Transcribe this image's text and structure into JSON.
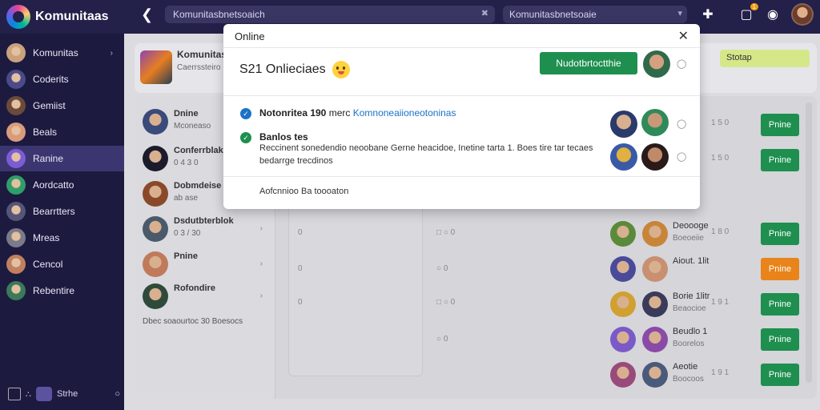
{
  "topbar": {
    "app_title": "Komunitaas",
    "search_value": "Komunitasbnetsoaich",
    "search_clear_icon": "x-icon",
    "filter_value": "Komunitasbnetsoaie",
    "filter_chevron": "chevron-down-icon",
    "notification_badge": "1"
  },
  "sidebar": {
    "items": [
      {
        "label": "Komunitas",
        "color": "#c9a27c",
        "has_chevron": true
      },
      {
        "label": "Coderits",
        "color": "#4b4b8a"
      },
      {
        "label": "Gemiist",
        "color": "#6b4a3a"
      },
      {
        "label": "Beals",
        "color": "#d99b7a"
      },
      {
        "label": "Ranine",
        "color": "#7c5cd6",
        "active": true
      },
      {
        "label": "Aordcatto",
        "color": "#2f9e6a"
      },
      {
        "label": "Bearrtters",
        "color": "#555577"
      },
      {
        "label": "Mreas",
        "color": "#7a7a8a"
      },
      {
        "label": "Cencol",
        "color": "#c08060"
      },
      {
        "label": "Rebentire",
        "color": "#3a7a5a"
      }
    ],
    "footer_label": "Strhe"
  },
  "header_card": {
    "title": "Komunitas",
    "subtitle": "Caerrssteiro",
    "status_tag": "Stotap"
  },
  "chat_list": [
    {
      "name": "Dnine",
      "sub": "Mconeaso",
      "color": "#3a4a7a"
    },
    {
      "name": "Conferrblak",
      "sub": "0 4 3 0",
      "color": "#1b1b2b"
    },
    {
      "name": "Dobmdeise",
      "sub": "ab ase",
      "color": "#8a4a2a"
    },
    {
      "name": "Dsdutbterblok",
      "sub": "0 3 / 30",
      "color": "#4a5a6a"
    },
    {
      "name": "Pnine",
      "sub": "",
      "color": "#c07a5a"
    },
    {
      "name": "Rofondire",
      "sub": "",
      "color": "#2f4a3a"
    }
  ],
  "chat_footer": "Dbec soaourtoc 30 Boesocs",
  "members": [
    {
      "name": "Deoooge",
      "sub": "Boeoeiie",
      "num": "1 8 0",
      "btn": "Pnine",
      "btn_color": "#1e8f4f",
      "c1": "#5a8a3a",
      "c2": "#c8853a"
    },
    {
      "name": "Aiout. 1lit",
      "sub": "",
      "num": "",
      "btn": "Pnine",
      "btn_color": "#e8841a",
      "c1": "#4a4a9a",
      "c2": "#c89070"
    },
    {
      "name": "Borie 1litr",
      "sub": "Beaocioe",
      "num": "1 9 1",
      "btn": "Pnine",
      "btn_color": "#1e8f4f",
      "c1": "#d0a030",
      "c2": "#3a3a5a"
    },
    {
      "name": "Beudlo 1",
      "sub": "Boorelos",
      "num": "",
      "btn": "Pnine",
      "btn_color": "#1e8f4f",
      "c1": "#7a5ac8",
      "c2": "#8a4aa8"
    },
    {
      "name": "Aeotie",
      "sub": "Boocoos",
      "num": "1 9 1",
      "btn": "Pnine",
      "btn_color": "#1e8f4f",
      "c1": "#9a4a7a",
      "c2": "#4a5a7a"
    },
    {
      "name": "",
      "sub": "",
      "num": "1 5 0",
      "btn": "Pnine",
      "btn_color": "#1e8f4f",
      "c1": "",
      "c2": ""
    },
    {
      "name": "",
      "sub": "",
      "num": "1 5 0",
      "btn": "Pnine",
      "btn_color": "#1e8f4f",
      "c1": "",
      "c2": ""
    }
  ],
  "modal": {
    "title": "Online",
    "headline": "S21 Onlieciaes",
    "primary_button": "Nudotbrtoctthie",
    "item1_title": "Notonritea 190",
    "item1_rest": "merc",
    "item1_link": "Komnoneaiioneotoninas",
    "item2_title": "Banlos tes",
    "item2_desc": "Reccinent sonedendio neoobane Gerne heacidoe, Inetine tarta 1. Boes tire tar tecaes",
    "item2_link": "bedarrge trecdinos",
    "footer": "Aofcnnioo   Ba toooaton",
    "accent_green": "#1e8f4f",
    "accent_blue": "#1a73c8"
  }
}
